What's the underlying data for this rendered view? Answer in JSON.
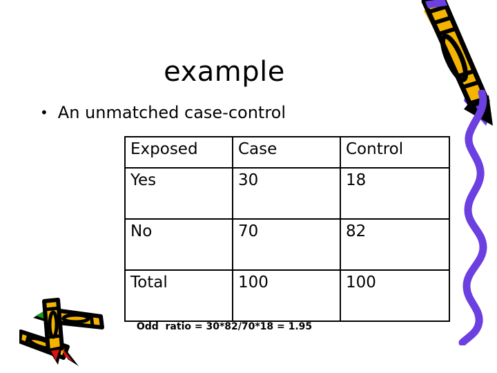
{
  "slide": {
    "title": "example",
    "bullet": {
      "marker": "•",
      "text": "An unmatched case-control"
    },
    "footnote": "Odd  ratio = 30*82/70*18 = 1.95"
  },
  "table": {
    "headers": [
      "Exposed",
      "Case",
      "Control"
    ],
    "rows": [
      [
        "Yes",
        "30",
        "18"
      ],
      [
        "No",
        "70",
        "82"
      ],
      [
        "Total",
        "100",
        "100"
      ]
    ]
  },
  "chart_data": {
    "type": "table",
    "title": "example",
    "caption": "Odd  ratio = 30*82/70*18 = 1.95",
    "columns": [
      "Exposed",
      "Case",
      "Control"
    ],
    "rows": [
      [
        "Yes",
        30,
        18
      ],
      [
        "No",
        70,
        82
      ],
      [
        "Total",
        100,
        100
      ]
    ],
    "odds_ratio": 1.95
  },
  "decor": {
    "crayon_body_color": "#f5b400",
    "crayon_outline_color": "#000000",
    "purple_color": "#6b3fe0",
    "green_color": "#1a9e1a",
    "red_color": "#e01010",
    "crayon_topright_name": "gold crayon with purple tip",
    "squiggle_name": "purple wavy scribble line",
    "crayons_bottomleft_name": "crossed crayons with green and red tips"
  }
}
